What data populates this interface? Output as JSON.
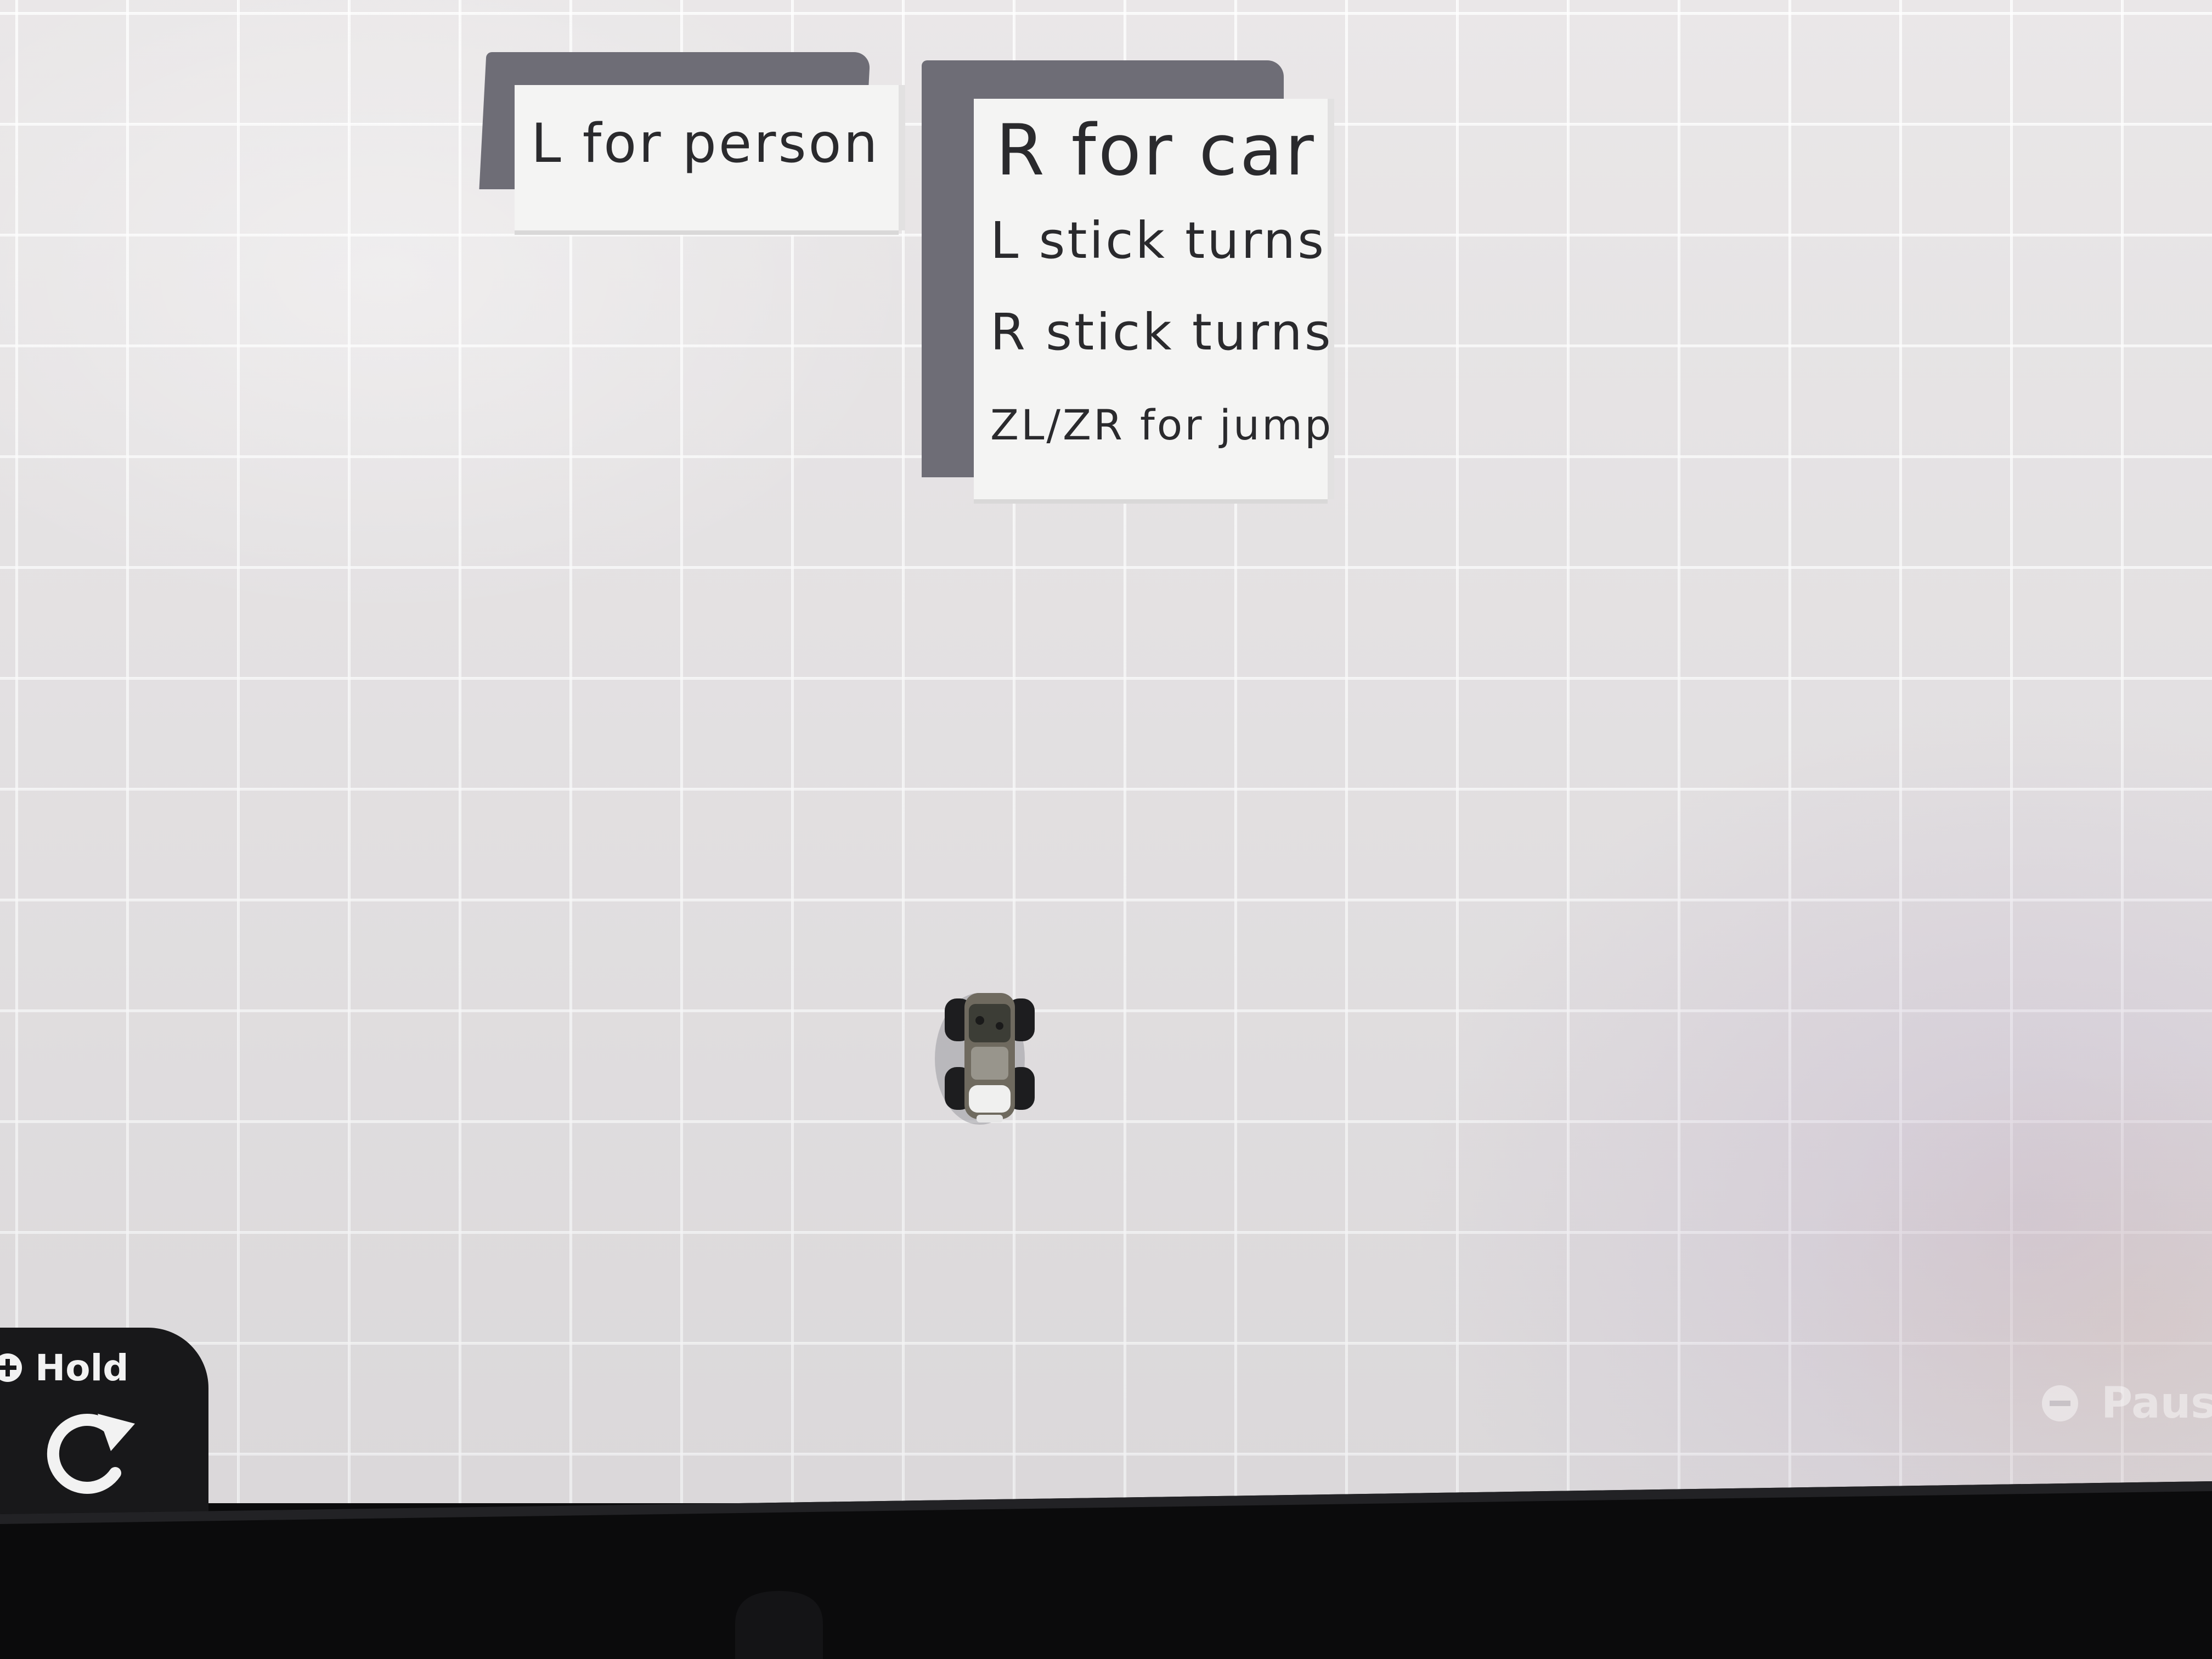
{
  "signs": {
    "person_sign": {
      "line1": "L for person"
    },
    "car_sign": {
      "title": "R for car",
      "line1": "L stick turns",
      "line2": "R stick turns",
      "line3": "ZL/ZR for jump"
    }
  },
  "hud": {
    "hold": {
      "icon": "plus-icon",
      "label": "Hold",
      "action_icon": "rotate-icon"
    },
    "pause": {
      "icon": "minus-icon",
      "label": "Paus"
    }
  },
  "colors": {
    "floor": "#e6e3e4",
    "sign_face": "#f4f4f3",
    "sign_text": "#2a2a2d",
    "hud_panel": "#18181a",
    "bezel": "#0b0b0c"
  }
}
